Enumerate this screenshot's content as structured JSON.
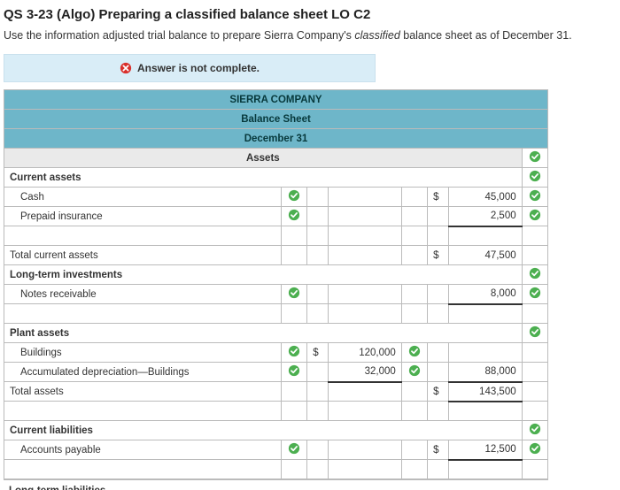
{
  "title": "QS 3-23 (Algo) Preparing a classified balance sheet LO C2",
  "instruction_pre": "Use the information adjusted trial balance to prepare Sierra Company's ",
  "instruction_em": "classified",
  "instruction_post": " balance sheet as of December 31.",
  "banner": "Answer is not complete.",
  "header": {
    "company": "SIERRA COMPANY",
    "stmt": "Balance Sheet",
    "date": "December 31"
  },
  "sections": {
    "assets": "Assets",
    "current_assets": "Current assets",
    "cash": "Cash",
    "prepaid": "Prepaid insurance",
    "tca": "Total current assets",
    "lti": "Long-term investments",
    "notes": "Notes receivable",
    "plant": "Plant assets",
    "build": "Buildings",
    "accdep": "Accumulated depreciation—Buildings",
    "ta": "Total assets",
    "cl": "Current liabilities",
    "ap": "Accounts payable",
    "ltl": "Long-term liabilities"
  },
  "vals": {
    "cash": "45,000",
    "prepaid": "2,500",
    "tca": "47,500",
    "notes": "8,000",
    "build": "120,000",
    "accdep": "32,000",
    "net_plant": "88,000",
    "ta": "143,500",
    "ap": "12,500"
  },
  "dollar": "$"
}
